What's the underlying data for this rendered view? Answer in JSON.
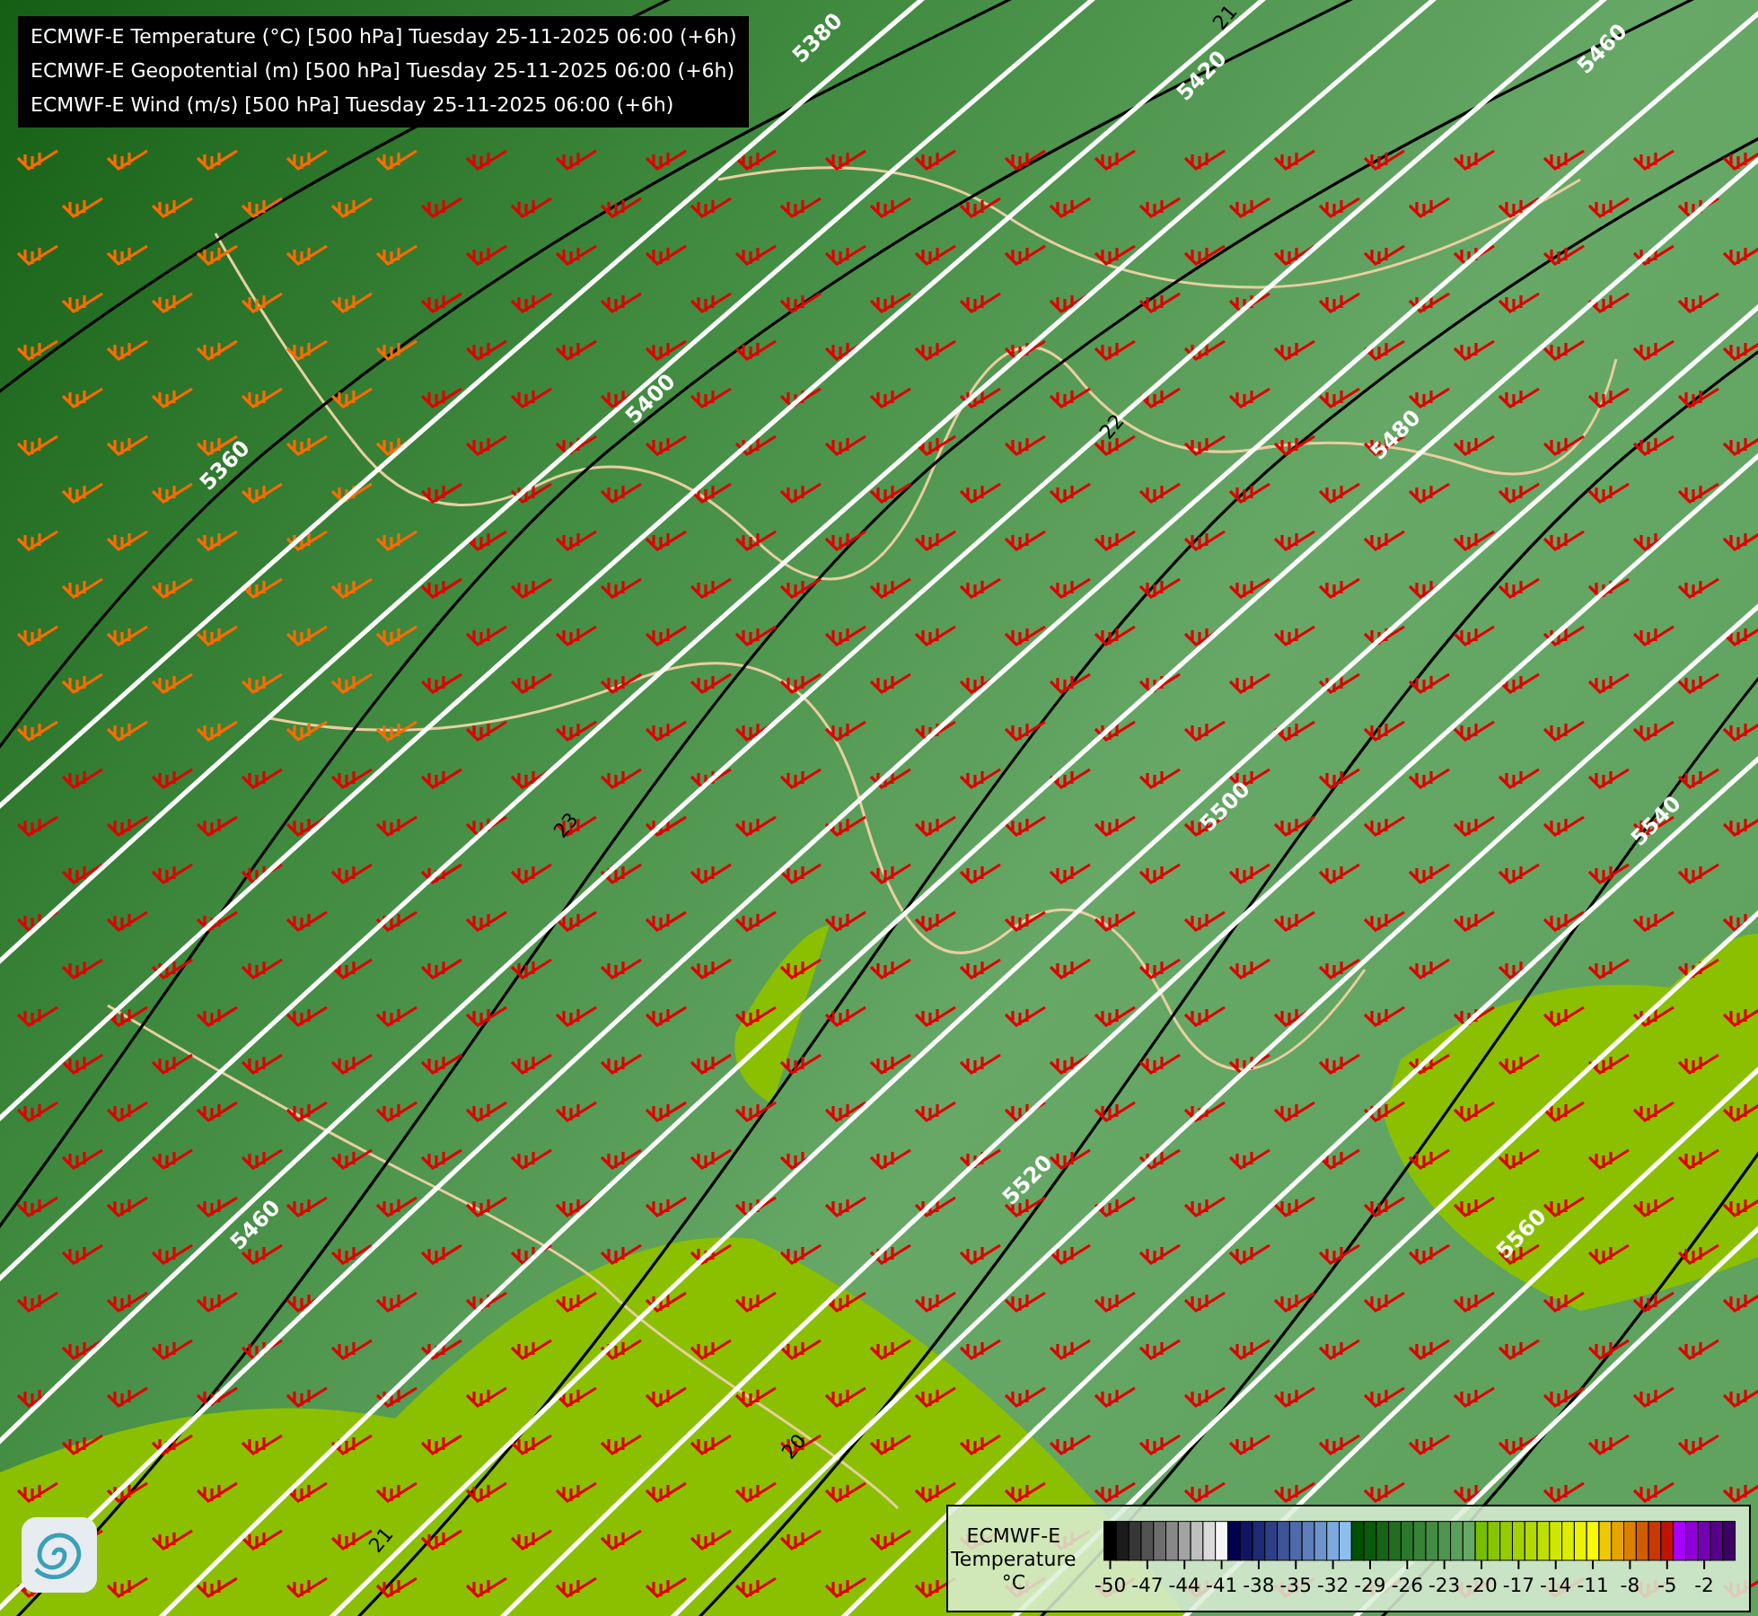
{
  "title_lines": [
    "ECMWF-E Temperature (°C) [500 hPa] Tuesday 25-11-2025 06:00 (+6h)",
    "ECMWF-E Geopotential (m) [500 hPa] Tuesday 25-11-2025 06:00 (+6h)",
    "ECMWF-E Wind (m/s) [500 hPa] Tuesday 25-11-2025 06:00 (+6h)"
  ],
  "map": {
    "geopotential_labels": [
      "5380",
      "5420",
      "5460",
      "5360",
      "5400",
      "5480",
      "5500",
      "5540",
      "5520",
      "5460",
      "5560"
    ],
    "temperature_labels": [
      "21",
      "22",
      "23",
      "20",
      "21"
    ]
  },
  "legend": {
    "title_lines": [
      "ECMWF-E",
      "Temperature",
      "°C"
    ],
    "ticks": [
      "-50",
      "-47",
      "-44",
      "-41",
      "-38",
      "-35",
      "-32",
      "-29",
      "-26",
      "-23",
      "-20",
      "-17",
      "-14",
      "-11",
      "-8",
      "-5",
      "-2"
    ]
  }
}
